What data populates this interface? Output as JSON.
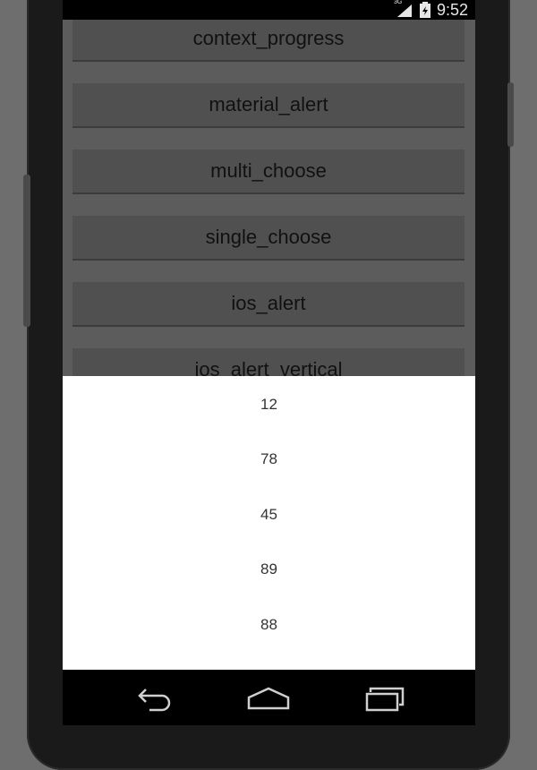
{
  "status_bar": {
    "time": "9:52",
    "network": "3G",
    "icons": [
      "signal-icon",
      "battery-icon"
    ]
  },
  "buttons": [
    {
      "label": "context_progress"
    },
    {
      "label": "material_alert"
    },
    {
      "label": "multi_choose"
    },
    {
      "label": "single_choose"
    },
    {
      "label": "ios_alert"
    },
    {
      "label": "ios_alert_vertical"
    }
  ],
  "picker": {
    "items": [
      "12",
      "78",
      "45",
      "89",
      "88"
    ]
  },
  "navigation": {
    "icons": [
      "back-icon",
      "home-icon",
      "recent-apps-icon"
    ]
  },
  "colors": {
    "content_background": "#5c5c5c",
    "button_background": "#505050",
    "sheet_background": "#ffffff"
  }
}
